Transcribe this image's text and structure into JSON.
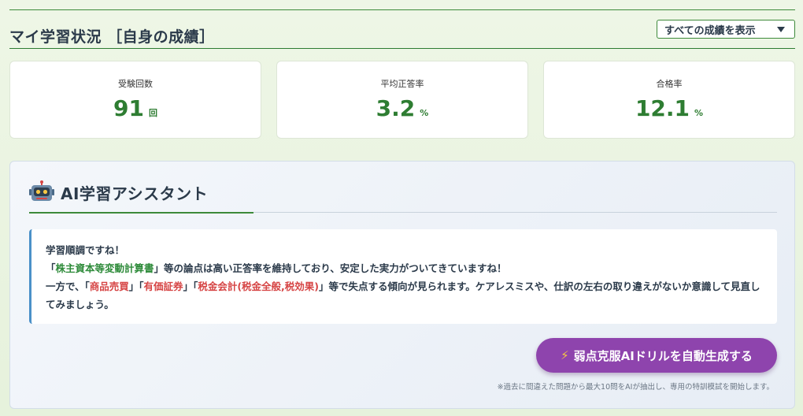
{
  "header": {
    "title": "マイ学習状況 ［自身の成績］",
    "filter": {
      "selected": "すべての成績を表示"
    }
  },
  "stats": [
    {
      "label": "受験回数",
      "value": "91",
      "unit": "回"
    },
    {
      "label": "平均正答率",
      "value": "3.2",
      "unit": "%"
    },
    {
      "label": "合格率",
      "value": "12.1",
      "unit": "%"
    }
  ],
  "assistant": {
    "icon": "robot-icon",
    "title": "AI学習アシスタント",
    "message": {
      "greeting": "学習順調ですね！",
      "l2_open": "「",
      "l2_topic": "株主資本等変動計算書",
      "l2_rest": "」等の論点は高い正答率を維持しており、安定した実力がついてきていますね！",
      "l3_prefix": "一方で、「",
      "l3_topic1": "商品売買",
      "l3_sep1": "」「",
      "l3_topic2": "有価証券",
      "l3_sep2": "」「",
      "l3_topic3": "税金会計(税金全般,税効果)",
      "l3_rest": "」等で失点する傾向が見られます。ケアレスミスや、仕訳の左右の取り違えがないか意識して見直してみましょう。"
    },
    "button_icon": "⚡",
    "button_label": "弱点克服AIドリルを自動生成する",
    "note": "※過去に間違えた問題から最大10問をAIが抽出し、専用の特訓模試を開始します。"
  },
  "colors": {
    "accent_green": "#2e7d32",
    "button_purple": "#8e44ad",
    "highlight_green": "#2e8b3a",
    "highlight_red": "#d64545"
  }
}
